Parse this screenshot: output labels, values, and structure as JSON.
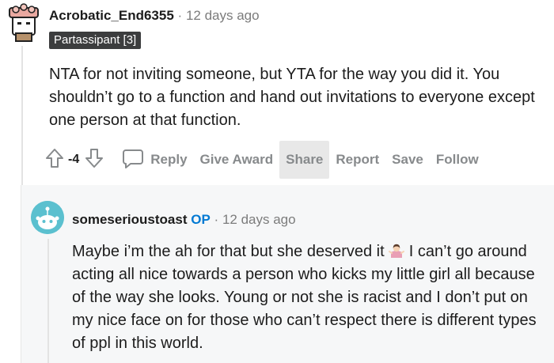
{
  "comment": {
    "username": "Acrobatic_End6355",
    "separator": "·",
    "time": "12 days ago",
    "flair": "Partassipant [3]",
    "body": "NTA for not inviting someone, but YTA for the way you did it. You shouldn’t go to a function and hand out invitations to everyone except one person at that function.",
    "score": "-4",
    "actions": {
      "reply": "Reply",
      "give_award": "Give Award",
      "share": "Share",
      "report": "Report",
      "save": "Save",
      "follow": "Follow"
    }
  },
  "reply": {
    "username": "someserioustoast",
    "op_badge": "OP",
    "separator": "·",
    "time": "12 days ago",
    "body_part1": "Maybe i’m the ah for that but she deserved it ",
    "body_part2": " I can’t go around acting all nice towards a person who kicks my little girl all because of the way she looks. Young or not she is racist and I don’t put on my nice face on for those who can’t respect there is different types of ppl in this world."
  },
  "icons": {
    "upvote": "arrow-up-icon",
    "downvote": "arrow-down-icon",
    "reply": "comment-bubble-icon",
    "emoji": "woman-shrugging-emoji"
  },
  "colors": {
    "accent_op": "#0079d3",
    "flair_bg": "#3c3d3e",
    "muted": "#878a8c"
  }
}
